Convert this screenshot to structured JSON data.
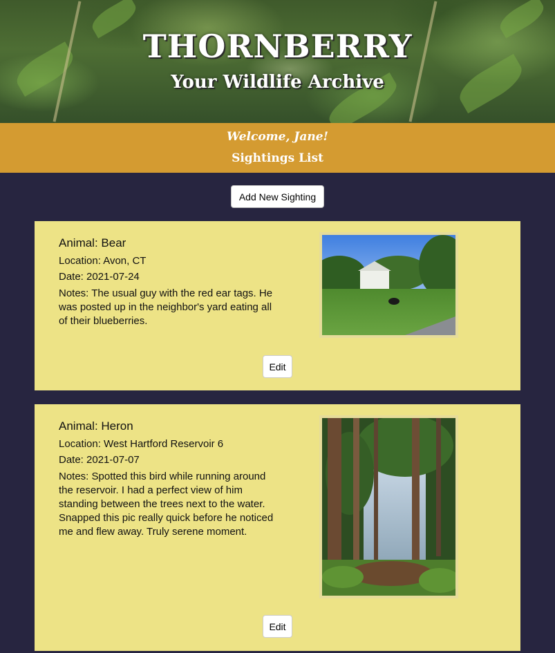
{
  "header": {
    "title": "THORNBERRY",
    "subtitle": "Your Wildlife Archive"
  },
  "banner": {
    "welcome": "Welcome, Jane!",
    "page_title": "Sightings List"
  },
  "actions": {
    "add_label": "Add New Sighting"
  },
  "sightings": [
    {
      "animal": "Animal: Bear",
      "location": "Location: Avon, CT",
      "date": "Date: 2021-07-24",
      "notes": "Notes: The usual guy with the red ear tags. He was posted up in the neighbor's yard eating all of their blueberries.",
      "edit_label": "Edit"
    },
    {
      "animal": "Animal: Heron",
      "location": "Location: West Hartford Reservoir 6",
      "date": "Date: 2021-07-07",
      "notes": "Notes: Spotted this bird while running around the reservoir. I had a perfect view of him standing between the trees next to the water. Snapped this pic really quick before he noticed me and flew away. Truly serene moment.",
      "edit_label": "Edit"
    }
  ],
  "colors": {
    "background": "#272540",
    "banner": "#d49b31",
    "card": "#ede386"
  }
}
